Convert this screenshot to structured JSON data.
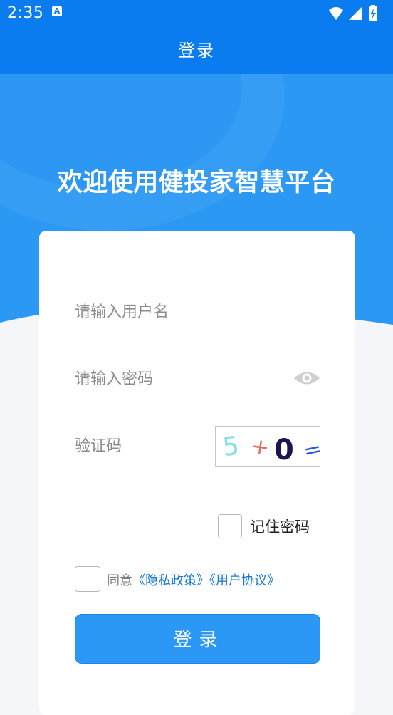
{
  "status_bar": {
    "time": "2:35",
    "notification_letter": "A",
    "icons": [
      "wifi-icon",
      "signal-icon",
      "battery-charging-icon"
    ]
  },
  "app_bar": {
    "title": "登录"
  },
  "hero": {
    "title": "欢迎使用健投家智慧平台"
  },
  "form": {
    "username": {
      "value": "",
      "placeholder": "请输入用户名"
    },
    "password": {
      "value": "",
      "placeholder": "请输入密码",
      "toggle_icon": "eye-icon"
    },
    "captcha": {
      "value": "",
      "placeholder": "验证码",
      "image_chars": [
        "5",
        "+",
        "0",
        "="
      ],
      "image_colors": [
        "#7ee0e6",
        "#e06b5d",
        "#1c1550",
        "#2357d8"
      ]
    },
    "remember_label": "记住密码",
    "remember_checked": false,
    "agree": {
      "checked": false,
      "prefix": "同意",
      "privacy_link": "《隐私政策》",
      "terms_link": "《用户协议》"
    },
    "submit_label": "登录"
  },
  "colors": {
    "primary": "#0a7cf0",
    "hero": "#2b98f4",
    "button": "#2c98f5",
    "link": "#1479d4",
    "background": "#f4f6f9"
  }
}
